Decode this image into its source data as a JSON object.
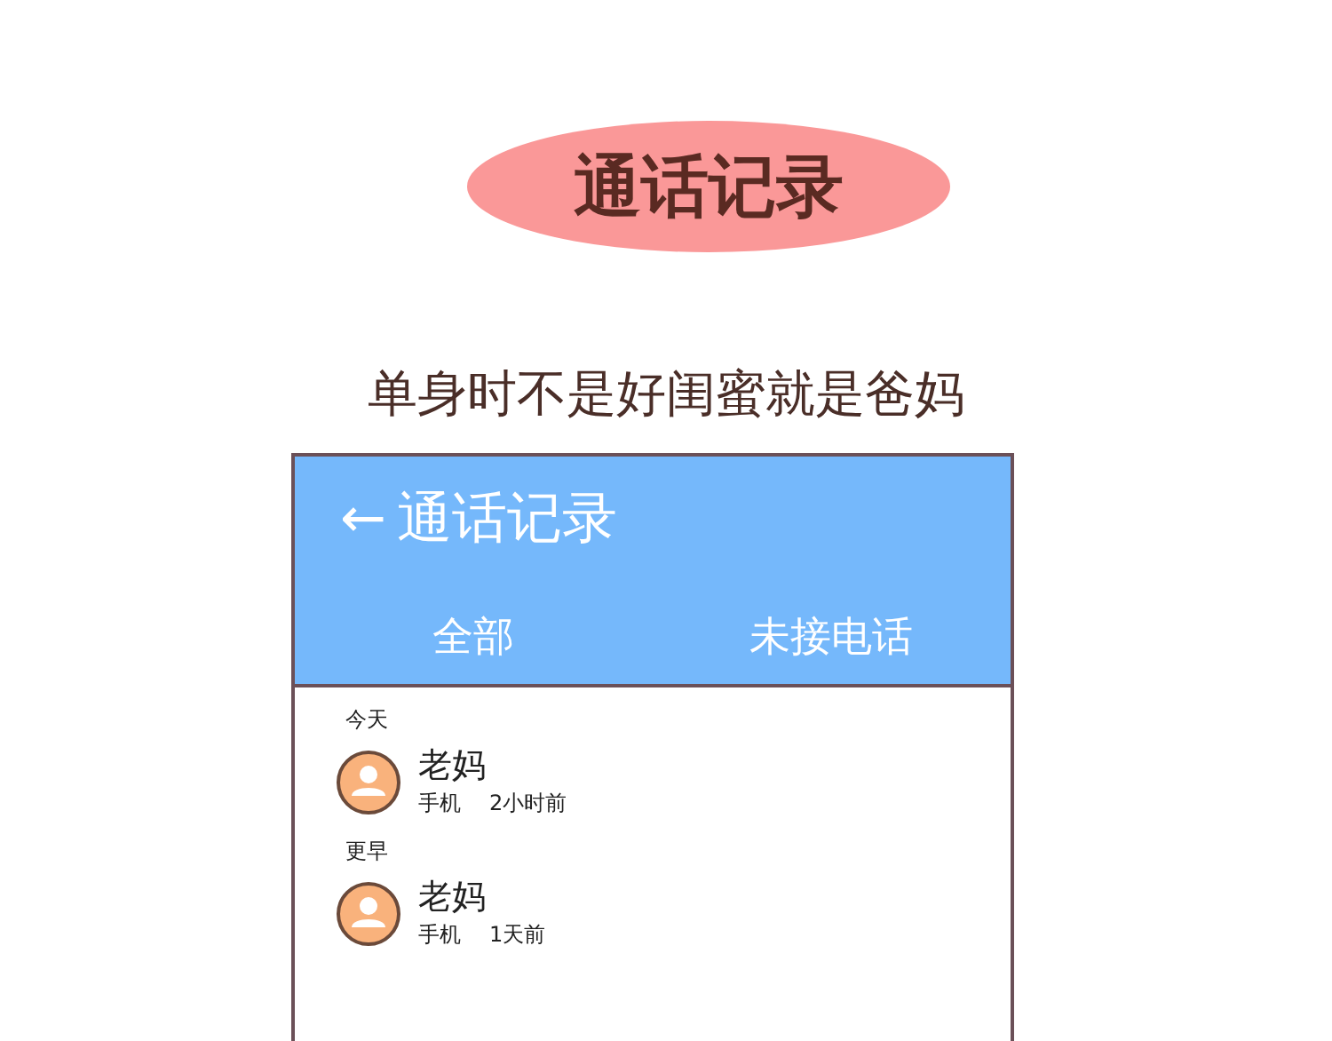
{
  "banner": {
    "title": "通话记录"
  },
  "caption": "单身时不是好闺蜜就是爸妈",
  "phone": {
    "title": "通话记录",
    "back_icon": "←",
    "tabs": [
      {
        "label": "全部"
      },
      {
        "label": "未接电话"
      }
    ],
    "sections": [
      {
        "heading": "今天",
        "calls": [
          {
            "name": "老妈",
            "type": "手机",
            "time": "2小时前"
          }
        ]
      },
      {
        "heading": "更早",
        "calls": [
          {
            "name": "老妈",
            "type": "手机",
            "time": "1天前"
          }
        ]
      }
    ]
  }
}
